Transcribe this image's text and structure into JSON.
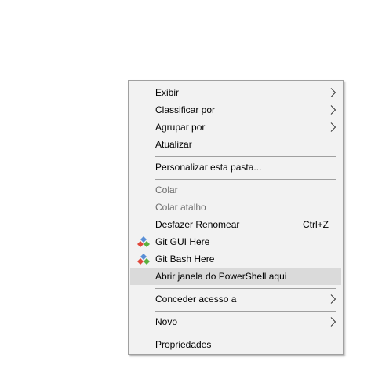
{
  "menu": {
    "items": [
      {
        "label": "Exibir"
      },
      {
        "label": "Classificar por"
      },
      {
        "label": "Agrupar por"
      },
      {
        "label": "Atualizar"
      },
      {
        "label": "Personalizar esta pasta..."
      },
      {
        "label": "Colar"
      },
      {
        "label": "Colar atalho"
      },
      {
        "label": "Desfazer Renomear",
        "shortcut": "Ctrl+Z"
      },
      {
        "label": "Git GUI Here",
        "icon": "git-icon"
      },
      {
        "label": "Git Bash Here",
        "icon": "git-icon"
      },
      {
        "label": "Abrir janela do PowerShell aqui"
      },
      {
        "label": "Conceder acesso a"
      },
      {
        "label": "Novo"
      },
      {
        "label": "Propriedades"
      }
    ]
  },
  "colors": {
    "menu_bg": "#f2f2f2",
    "hover_bg": "#dadada",
    "border": "#a0a0a0",
    "disabled_text": "#6d6d6d",
    "git_blue": "#5a8fd6",
    "git_red": "#e0473a",
    "git_green": "#5ab13e"
  }
}
